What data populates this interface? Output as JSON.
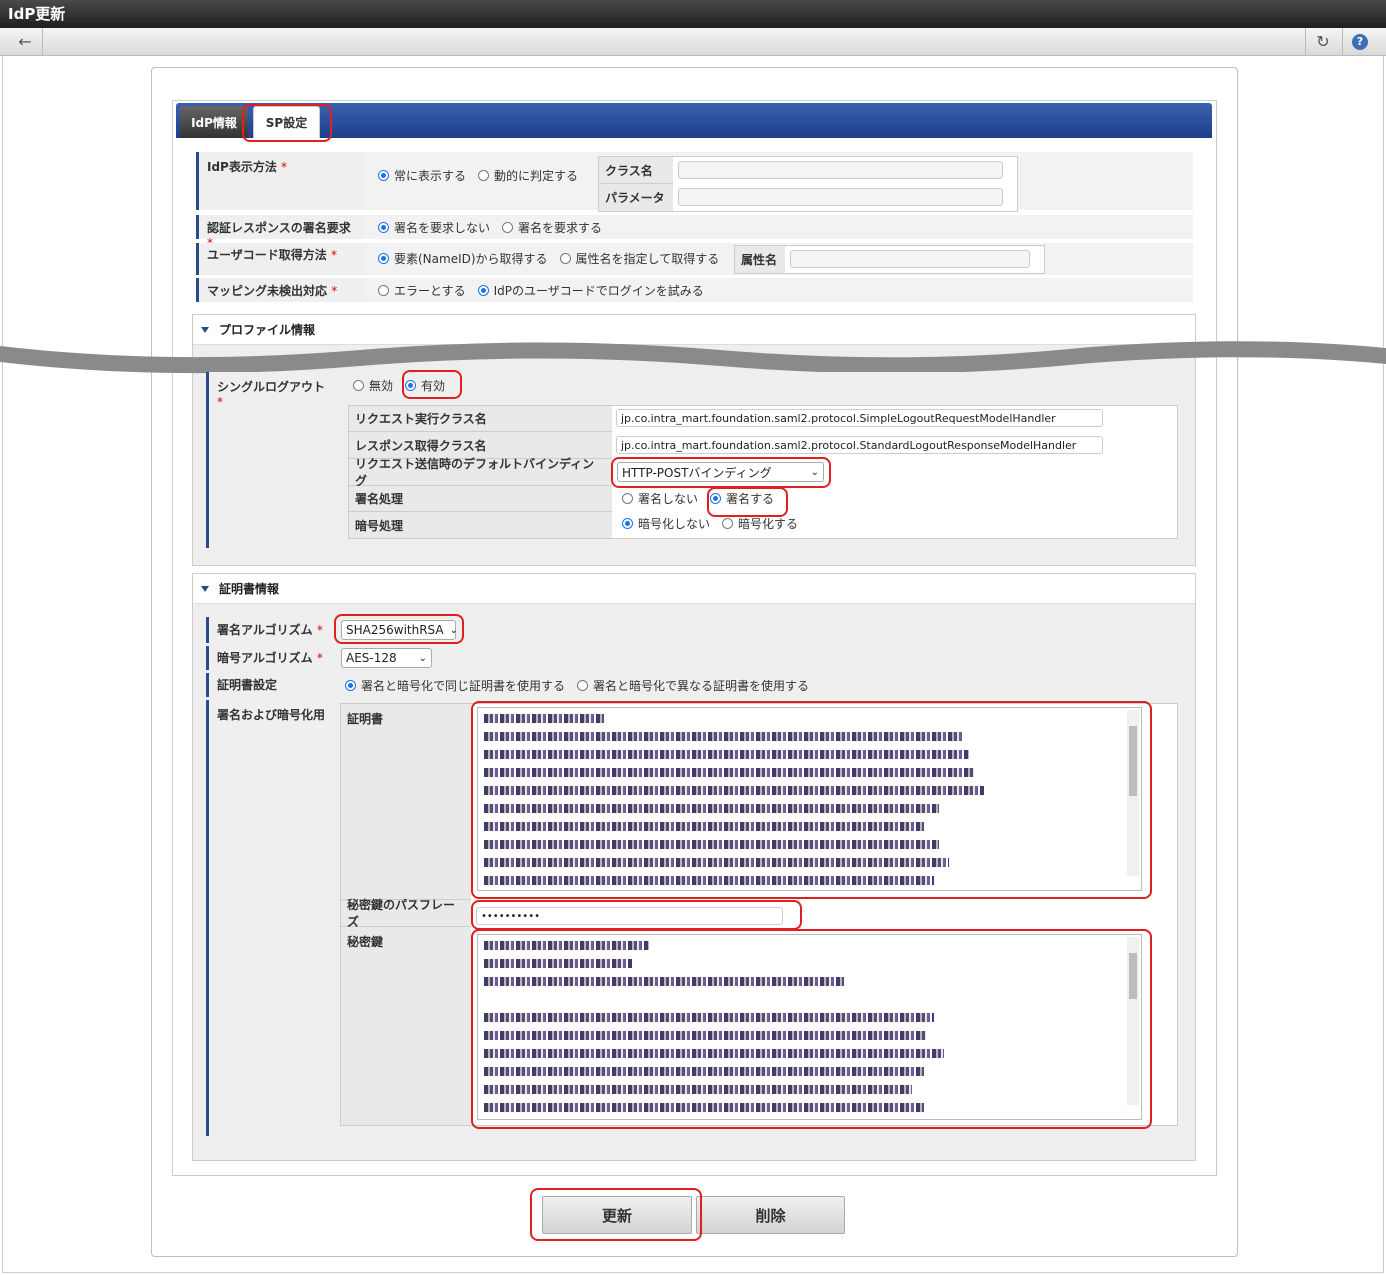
{
  "window": {
    "title": "IdP更新"
  },
  "tabs": [
    {
      "label": "IdP情報"
    },
    {
      "label": "SP設定"
    }
  ],
  "idp_display": {
    "label": "IdP表示方法",
    "options": [
      "常に表示する",
      "動的に判定する"
    ],
    "selected": 0,
    "class_name_label": "クラス名",
    "class_name_value": "",
    "parameter_label": "パラメータ",
    "parameter_value": ""
  },
  "auth_response": {
    "label": "認証レスポンスの署名要求",
    "options": [
      "署名を要求しない",
      "署名を要求する"
    ],
    "selected": 0
  },
  "user_code": {
    "label": "ユーザコード取得方法",
    "options": [
      "要素(NameID)から取得する",
      "属性名を指定して取得する"
    ],
    "selected": 0,
    "attr_label": "属性名",
    "attr_value": ""
  },
  "mapping": {
    "label": "マッピング未検出対応",
    "options": [
      "エラーとする",
      "IdPのユーザコードでログインを試みる"
    ],
    "selected": 1
  },
  "required_mark": "*",
  "profile": {
    "title": "プロファイル情報",
    "single_logout": {
      "label": "シングルログアウト",
      "options": [
        "無効",
        "有効"
      ],
      "selected": 1
    },
    "request_class_label": "リクエスト実行クラス名",
    "request_class_value": "jp.co.intra_mart.foundation.saml2.protocol.SimpleLogoutRequestModelHandler",
    "response_class_label": "レスポンス取得クラス名",
    "response_class_value": "jp.co.intra_mart.foundation.saml2.protocol.StandardLogoutResponseModelHandler",
    "binding_label": "リクエスト送信時のデフォルトバインディング",
    "binding_value": "HTTP-POSTバインディング",
    "sign_label": "署名処理",
    "sign_options": [
      "署名しない",
      "署名する"
    ],
    "sign_selected": 1,
    "encrypt_label": "暗号処理",
    "encrypt_options": [
      "暗号化しない",
      "暗号化する"
    ],
    "encrypt_selected": 0
  },
  "cert": {
    "title": "証明書情報",
    "sign_algo_label": "署名アルゴリズム",
    "sign_algo_value": "SHA256withRSA",
    "enc_algo_label": "暗号アルゴリズム",
    "enc_algo_value": "AES-128",
    "cert_setting_label": "証明書設定",
    "cert_setting_options": [
      "署名と暗号化で同じ証明書を使用する",
      "署名と暗号化で異なる証明書を使用する"
    ],
    "cert_setting_selected": 0,
    "sign_enc_label": "署名および暗号化用",
    "certificate_label": "証明書",
    "passphrase_label": "秘密鍵のパスフレーズ",
    "passphrase_value": "••••••••••",
    "private_key_label": "秘密鍵"
  },
  "buttons": {
    "update": "更新",
    "delete": "削除"
  },
  "colors": {
    "tab_blue": "#2b4a8b",
    "highlight_red": "#e02020",
    "radio_on": "#1a73e8"
  }
}
